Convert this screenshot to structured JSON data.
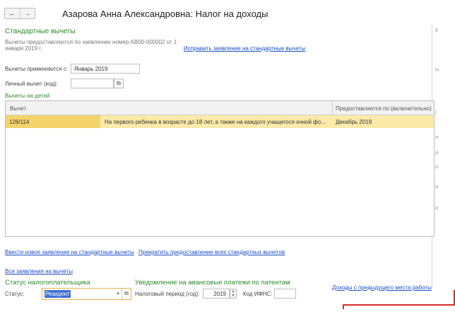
{
  "window": {
    "title": "Азарова Анна Александровна: Налог на доходы",
    "back_icon": "←",
    "forward_icon": "→"
  },
  "standard": {
    "heading": "Стандартные вычеты",
    "info_line1": "Вычеты предоставляются по заявлению номер АВ00-000002 от 1",
    "info_line2": "января 2019 г.",
    "fix_link": "Исправить заявление на стандартные вычеты",
    "applies_label": "Вычеты применяются с:",
    "applies_value": "Январь 2019",
    "personal_label": "Личный вычет (код):",
    "personal_value": "",
    "children_heading": "Вычеты на детей"
  },
  "grid": {
    "columns": [
      "Вычет",
      "Предоставляется по (включительно)"
    ],
    "rows": [
      {
        "code": "126/114",
        "description": "На первого ребенка в возрасте до 18 лет, а также на каждого учащегося очной фо...",
        "until": "Декабрь 2019"
      }
    ]
  },
  "links": {
    "new_application": "Ввести новое заявление на стандартные вычеты",
    "stop_all": "Прекратить предоставление всех стандартных вычетов",
    "all_applications": "Все заявления на вычеты",
    "prev_income": "Доходы с предыдущего места работы"
  },
  "taxpayer": {
    "heading": "Статус налогоплательщика",
    "status_label": "Статус:",
    "status_value": "Резидент"
  },
  "patent": {
    "heading": "Уведомление на авансовые платежи по патентам",
    "period_label": "Налоговый период (год):",
    "period_value": "2019",
    "ifns_label": "Код ИФНС:",
    "ifns_value": ""
  },
  "right_edge_marks": [
    "Е",
    "Н",
    "(",
    "Р",
    "Р",
    "Р",
    "Р",
    "Р"
  ]
}
